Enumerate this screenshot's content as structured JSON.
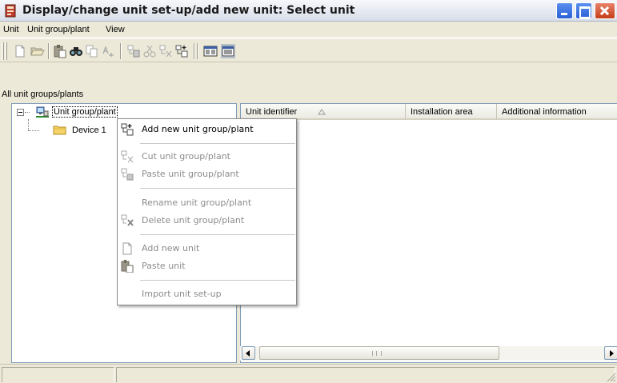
{
  "window": {
    "title": "Display/change unit set-up/add new unit: Select unit"
  },
  "menubar": {
    "items": [
      {
        "label": "Unit"
      },
      {
        "label": "Unit group/plant"
      },
      {
        "label": "View"
      }
    ]
  },
  "toolbar": {
    "icons": [
      "new-document-icon",
      "open-folder-icon",
      "paste-icon",
      "find-icon",
      "copy-icon",
      "sort-icon",
      "paste-unit-group-icon",
      "cut-icon",
      "cut-unit-group-icon",
      "add-unit-group-icon",
      "details-view-icon",
      "list-view-icon"
    ]
  },
  "left_panel": {
    "header": "All unit groups/plants",
    "tree": [
      {
        "label": "Unit group/plant",
        "expanded": true,
        "selected": true
      },
      {
        "label": "Device 1"
      }
    ]
  },
  "right_panel": {
    "columns": [
      {
        "label": "Unit identifier",
        "sorted": "ascending"
      },
      {
        "label": "Installation area"
      },
      {
        "label": "Additional information"
      }
    ],
    "scrollbar_grip": "III"
  },
  "context_menu": {
    "items": [
      {
        "label": "Add new unit group/plant",
        "enabled": true,
        "icon": "add-unit-group-icon"
      },
      {
        "label": "Cut unit group/plant",
        "enabled": false,
        "icon": "cut-unit-group-icon"
      },
      {
        "label": "Paste unit group/plant",
        "enabled": false,
        "icon": "paste-unit-group-icon"
      },
      {
        "label": "Rename unit group/plant",
        "enabled": false,
        "icon": ""
      },
      {
        "label": "Delete unit group/plant",
        "enabled": false,
        "icon": "delete-unit-group-icon"
      },
      {
        "label": "Add new unit",
        "enabled": false,
        "icon": "new-unit-icon"
      },
      {
        "label": "Paste unit",
        "enabled": true,
        "icon": "paste-unit-icon"
      },
      {
        "label": "Import unit set-up",
        "enabled": false,
        "icon": ""
      }
    ]
  },
  "colors": {
    "titlebar": "#e9ecf3",
    "window_bg": "#ece9d8",
    "close_button": "#c53d17",
    "border": "#7f9db9",
    "disabled_text": "#8c8c8c"
  }
}
